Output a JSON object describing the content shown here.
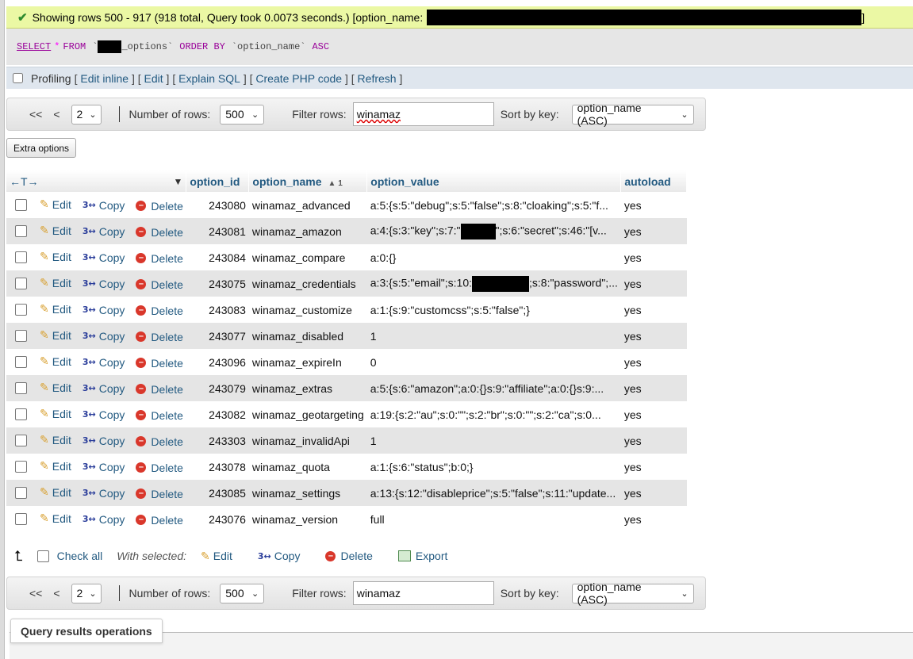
{
  "success": {
    "text": "Showing rows 500 - 917 (918 total, Query took 0.0073 seconds.) [option_name:",
    "end": "]"
  },
  "sql": {
    "select": "SELECT",
    "star": "*",
    "from": "FROM",
    "table_suffix": "_options`",
    "order": "ORDER BY",
    "column": "`option_name`",
    "dir": "ASC"
  },
  "profiling": {
    "label": "Profiling",
    "links": [
      "Edit inline",
      "Edit",
      "Explain SQL",
      "Create PHP code",
      "Refresh"
    ]
  },
  "navigation": {
    "first": "<<",
    "prev": "<",
    "page": "2",
    "rows_label": "Number of rows:",
    "rows_value": "500",
    "filter_label": "Filter rows:",
    "filter_value": "winamaz",
    "sort_label": "Sort by key:",
    "sort_value": "option_name (ASC)"
  },
  "extra_options": "Extra options",
  "table": {
    "arrows": "←T→",
    "headers": {
      "option_id": "option_id",
      "option_name": "option_name",
      "sort_marker": "▲ 1",
      "option_value": "option_value",
      "autoload": "autoload"
    },
    "action_labels": {
      "edit": "Edit",
      "copy": "Copy",
      "delete": "Delete"
    },
    "rows": [
      {
        "id": "243080",
        "name": "winamaz_advanced",
        "value": "a:5:{s:5:\"debug\";s:5:\"false\";s:8:\"cloaking\";s:5:\"f...",
        "autoload": "yes"
      },
      {
        "id": "243081",
        "name": "winamaz_amazon",
        "value_pre": "a:4:{s:3:\"key\";s:7:\"",
        "value_post": "\";s:6:\"secret\";s:46:\"[v...",
        "autoload": "yes"
      },
      {
        "id": "243084",
        "name": "winamaz_compare",
        "value": "a:0:{}",
        "autoload": "yes"
      },
      {
        "id": "243075",
        "name": "winamaz_credentials",
        "value_pre": "a:3:{s:5:\"email\";s:10:",
        "value_post": ";s:8:\"password\";...",
        "autoload": "yes"
      },
      {
        "id": "243083",
        "name": "winamaz_customize",
        "value": "a:1:{s:9:\"customcss\";s:5:\"false\";}",
        "autoload": "yes"
      },
      {
        "id": "243077",
        "name": "winamaz_disabled",
        "value": "1",
        "autoload": "yes"
      },
      {
        "id": "243096",
        "name": "winamaz_expireIn",
        "value": "0",
        "autoload": "yes"
      },
      {
        "id": "243079",
        "name": "winamaz_extras",
        "value": "a:5:{s:6:\"amazon\";a:0:{}s:9:\"affiliate\";a:0:{}s:9:...",
        "autoload": "yes"
      },
      {
        "id": "243082",
        "name": "winamaz_geotargeting",
        "value": "a:19:{s:2:\"au\";s:0:\"\";s:2:\"br\";s:0:\"\";s:2:\"ca\";s:0...",
        "autoload": "yes"
      },
      {
        "id": "243303",
        "name": "winamaz_invalidApi",
        "value": "1",
        "autoload": "yes"
      },
      {
        "id": "243078",
        "name": "winamaz_quota",
        "value": "a:1:{s:6:\"status\";b:0;}",
        "autoload": "yes"
      },
      {
        "id": "243085",
        "name": "winamaz_settings",
        "value": "a:13:{s:12:\"disableprice\";s:5:\"false\";s:11:\"update...",
        "autoload": "yes"
      },
      {
        "id": "243076",
        "name": "winamaz_version",
        "value": "full",
        "autoload": "yes"
      }
    ]
  },
  "bulk": {
    "check_all": "Check all",
    "with_selected": "With selected:",
    "edit": "Edit",
    "copy": "Copy",
    "delete": "Delete",
    "export": "Export"
  },
  "query_results_operations": "Query results operations"
}
